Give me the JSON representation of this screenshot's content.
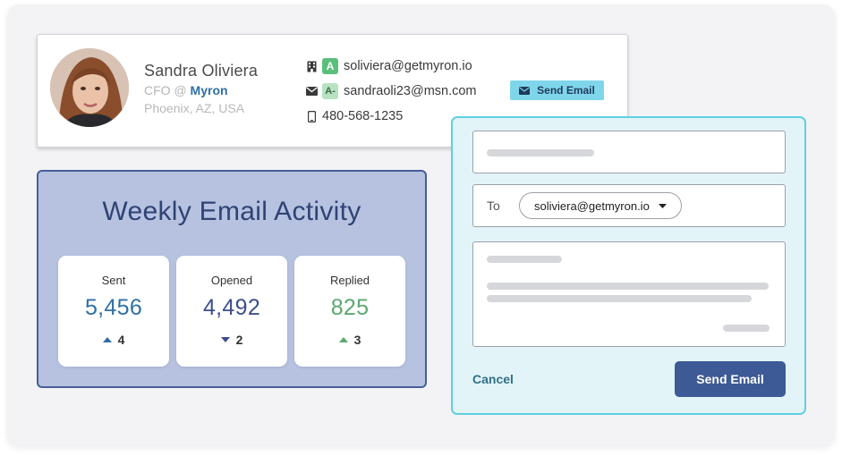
{
  "contact": {
    "name": "Sandra Oliviera",
    "role_prefix": "CFO @",
    "company": "Myron",
    "location": "Phoenix, AZ, USA",
    "work_email_badge": "A",
    "work_email": "soliviera@getmyron.io",
    "personal_email_badge": "A-",
    "personal_email": "sandraoli23@msn.com",
    "phone": "480-568-1235",
    "send_email_label": "Send Email",
    "icons": [
      "building-icon",
      "envelope-icon",
      "phone-icon"
    ]
  },
  "activity": {
    "title": "Weekly Email Activity",
    "stats": [
      {
        "label": "Sent",
        "value": "5,456",
        "change": "4",
        "direction": "up",
        "value_color": "#2f6fa8",
        "arrow_color": "#2f6fa8"
      },
      {
        "label": "Opened",
        "value": "4,492",
        "change": "2",
        "direction": "down",
        "value_color": "#3d4f8c",
        "arrow_color": "#3d4f8c"
      },
      {
        "label": "Replied",
        "value": "825",
        "change": "3",
        "direction": "up",
        "value_color": "#5aa870",
        "arrow_color": "#5aa870"
      }
    ]
  },
  "compose": {
    "to_label": "To",
    "recipient": "soliviera@getmyron.io",
    "cancel_label": "Cancel",
    "send_label": "Send Email"
  },
  "colors": {
    "panel_bg": "#b6c2e0",
    "panel_border": "#465e98",
    "compose_bg": "#e2f4f8",
    "compose_border": "#5fd0e0",
    "primary_button": "#3d5a96",
    "chip_bg": "#7fd6ea"
  }
}
